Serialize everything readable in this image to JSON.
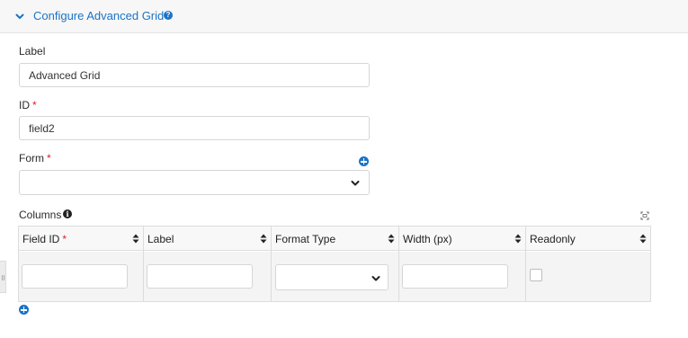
{
  "panel": {
    "title": "Configure Advanced Grid",
    "help_icon": "question-circle-icon",
    "collapse_icon": "chevron-down-icon"
  },
  "label_field": {
    "label": "Label",
    "value": "Advanced Grid"
  },
  "id_field": {
    "label": "ID",
    "required_mark": "*",
    "value": "field2"
  },
  "form_field": {
    "label": "Form",
    "required_mark": "*",
    "value": "",
    "add_icon": "plus-circle-icon"
  },
  "columns": {
    "label": "Columns",
    "info_icon": "info-circle-icon",
    "expand_icon": "expand-icon",
    "headers": [
      {
        "label": "Field ID",
        "required_mark": "*"
      },
      {
        "label": "Label",
        "required_mark": ""
      },
      {
        "label": "Format Type",
        "required_mark": ""
      },
      {
        "label": "Width (px)",
        "required_mark": ""
      },
      {
        "label": "Readonly",
        "required_mark": ""
      }
    ],
    "row": {
      "field_id": "",
      "label": "",
      "format_type": "",
      "width": "",
      "readonly": false
    },
    "add_row_icon": "plus-circle-icon"
  },
  "colors": {
    "accent": "#1a73c7",
    "required": "#e02020"
  }
}
